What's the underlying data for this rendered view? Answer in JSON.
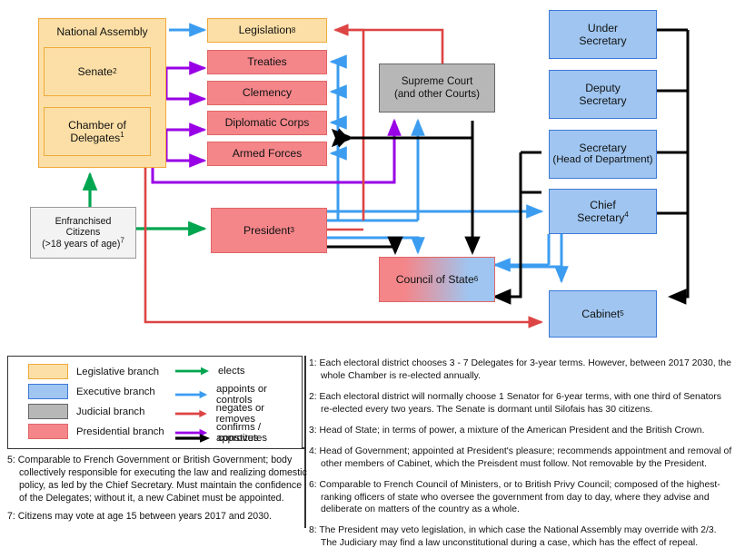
{
  "diagram": {
    "nodes": {
      "national_assembly": {
        "label": "National Assembly",
        "branch": "Legislative branch"
      },
      "senate": {
        "label": "Senate",
        "note": "2",
        "branch": "Legislative branch"
      },
      "chamber_of_delegates": {
        "label_line1": "Chamber of",
        "label_line2": "Delegates",
        "note": "1",
        "branch": "Legislative branch"
      },
      "enfranchised_citizens": {
        "label_line1": "Enfranchised",
        "label_line2": "Citizens",
        "label_line3": "(>18 years of age)",
        "note": "7",
        "branch": "none"
      },
      "legislation": {
        "label": "Legislation",
        "note": "8",
        "branch": "Legislative branch"
      },
      "treaties": {
        "label": "Treaties",
        "branch": "Presidential branch"
      },
      "clemency": {
        "label": "Clemency",
        "branch": "Presidential branch"
      },
      "diplomatic_corps": {
        "label": "Diplomatic Corps",
        "branch": "Presidential branch"
      },
      "armed_forces": {
        "label": "Armed Forces",
        "branch": "Presidential branch"
      },
      "supreme_court": {
        "label_line1": "Supreme Court",
        "label_line2": "(and other Courts)",
        "branch": "Judicial branch"
      },
      "president": {
        "label": "President",
        "note": "3",
        "branch": "Presidential branch"
      },
      "council_of_state": {
        "label": "Council of State",
        "note": "6",
        "branch": "Presidential + Executive branch"
      },
      "under_secretary": {
        "label_line1": "Under",
        "label_line2": "Secretary",
        "branch": "Executive branch"
      },
      "deputy_secretary": {
        "label_line1": "Deputy",
        "label_line2": "Secretary",
        "branch": "Executive branch"
      },
      "secretary": {
        "label_line1": "Secretary",
        "label_line2": "(Head of Department)",
        "branch": "Executive branch"
      },
      "chief_secretary": {
        "label_line1": "Chief",
        "label_line2": "Secretary",
        "note": "4",
        "branch": "Executive branch"
      },
      "cabinet": {
        "label": "Cabinet",
        "note": "5",
        "branch": "Executive branch"
      }
    }
  },
  "legend": {
    "branches": [
      {
        "label": "Legislative branch",
        "color": "#FCDFA6",
        "border": "#F0A93B"
      },
      {
        "label": "Executive branch",
        "color": "#9FC5F0",
        "border": "#3C78D8"
      },
      {
        "label": "Judicial branch",
        "color": "#B7B7B7",
        "border": "#666666"
      },
      {
        "label": "Presidential branch",
        "color": "#F4868A",
        "border": "#E06666"
      }
    ],
    "arrows": [
      {
        "label": "elects",
        "color": "#00A550"
      },
      {
        "label": "appoints or controls",
        "color": "#3C9DF0"
      },
      {
        "label": "negates or removes",
        "color": "#DD4444"
      },
      {
        "label": "confirms / approves",
        "color": "#9900E6"
      },
      {
        "label": "constitutes",
        "color": "#000000"
      }
    ]
  },
  "notes_left": [
    "5: Comparable to French Government or British Government; body collectively responsible for executing the law and realizing domestic policy, as led by the Chief Secretary. Must maintain the confidence of the Delegates; without it, a new Cabinet must be appointed.",
    "7: Citizens may vote at age 15 between years 2017 and 2030."
  ],
  "notes_right": [
    "1: Each electoral district chooses 3 - 7 Delegates for 3-year terms. However, between 2017 2030, the whole Chamber is re-elected annually.",
    "2: Each electoral district will normally choose 1 Senator for 6-year terms, with one third of Senators re-elected every two years. The Senate is dormant until Silofais has 30 citizens.",
    "3: Head of State; in terms of power, a mixture of the American President and the British Crown.",
    "4: Head of Government; appointed at President's pleasure; recommends appointment and removal of other members of Cabinet, which the Preisdent must follow. Not removable by the President.",
    "6: Comparable to French Council of Ministers, or to British Privy Council; composed of the highest-ranking officers of state who oversee the government from day to day, where they advise and deliberate on matters of the country as a whole.",
    "8: The President may veto legislation, in which case the National Assembly may override with 2/3. The Judiciary may find a law unconstitutional during a case, which has the effect of repeal."
  ]
}
